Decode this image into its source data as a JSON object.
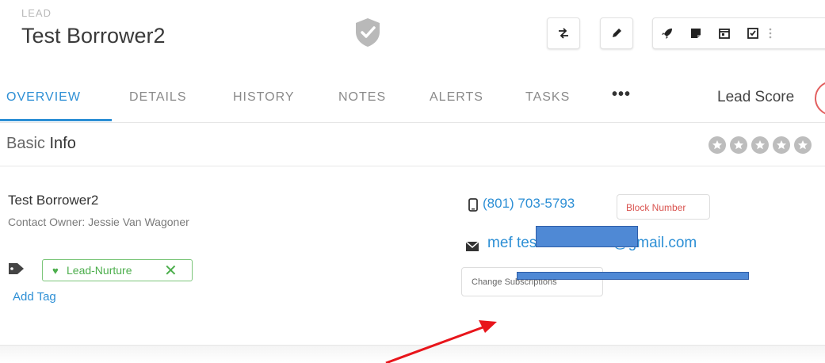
{
  "header": {
    "record_type": "LEAD",
    "record_name": "Test Borrower2"
  },
  "tabs": [
    {
      "label": "OVERVIEW",
      "active": true
    },
    {
      "label": "DETAILS",
      "active": false
    },
    {
      "label": "HISTORY",
      "active": false
    },
    {
      "label": "NOTES",
      "active": false
    },
    {
      "label": "ALERTS",
      "active": false
    },
    {
      "label": "TASKS",
      "active": false
    }
  ],
  "tabs_more": "•••",
  "lead_score_label": "Lead Score",
  "section": {
    "title_prefix": "Basic",
    "title_suffix": " Info",
    "rating_stars": 0
  },
  "contact": {
    "name": "Test Borrower2",
    "owner": "Contact Owner: Jessie Van Wagoner",
    "phone": "(801) 703-5793",
    "block_label": "Block Number",
    "email": "mef          test.borrower2@gmail.com",
    "change_subscriptions_label": "Change Subscriptions"
  },
  "tags": [
    {
      "label": "Lead-Nurture"
    }
  ],
  "add_tag_label": "Add Tag",
  "icons": [
    "shield-check-icon",
    "swap-icon",
    "pencil-icon",
    "rocket-icon",
    "note-icon",
    "calendar-icon",
    "checkbox-icon",
    "more-vertical-icon",
    "phone-icon",
    "mail-icon",
    "tag-icon",
    "heart-icon",
    "close-icon",
    "star-icon"
  ],
  "colors": {
    "accent": "#2d8fd5",
    "tag_green": "#4cae4c",
    "danger": "#d9534f",
    "redaction": "#4f89d5",
    "annotation_arrow": "#e8151b"
  }
}
